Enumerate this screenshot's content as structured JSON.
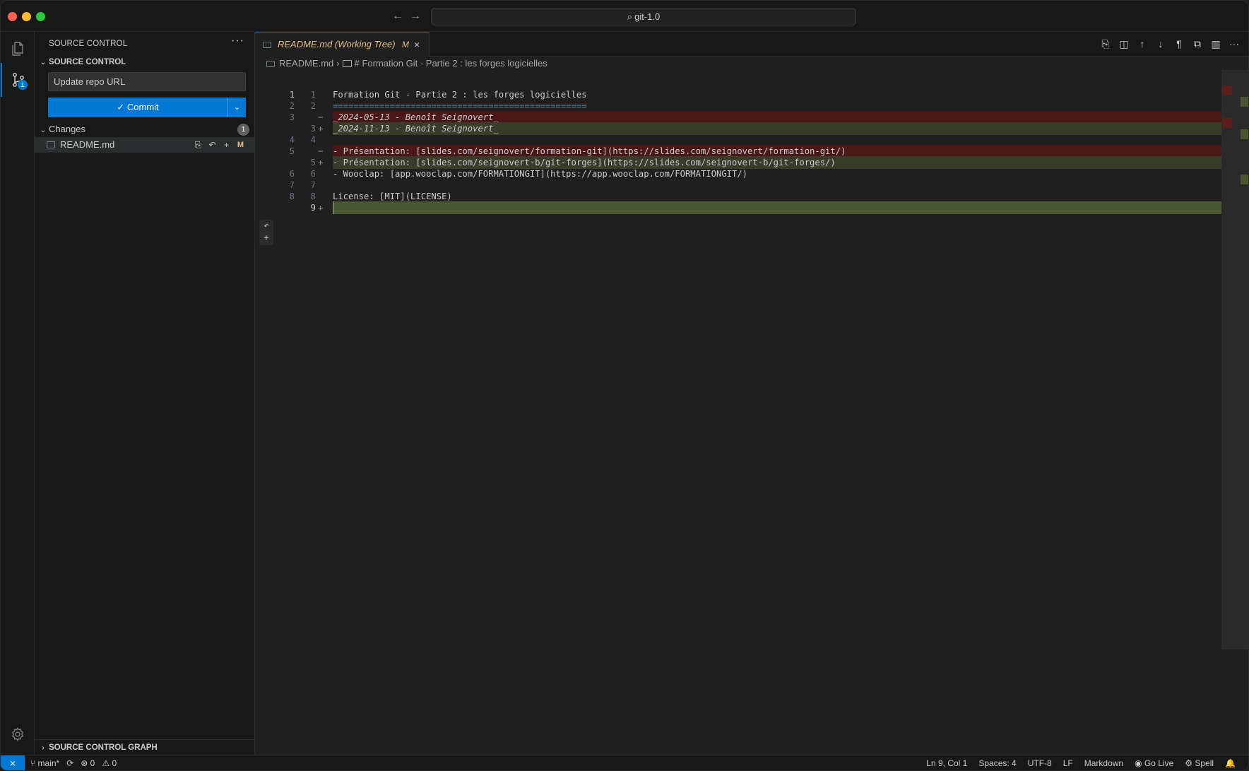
{
  "titlebar": {
    "title": "git-1.0",
    "back_glyph": "←",
    "forward_glyph": "→",
    "search_glyph": "⌕"
  },
  "activity": {
    "scm_badge": "1"
  },
  "sidebar": {
    "header": "SOURCE CONTROL",
    "more": "···",
    "section": "SOURCE CONTROL",
    "commit_message": "Update repo URL",
    "commit_label": "✓ Commit",
    "commit_dropdown": "⌄",
    "changes_label": "Changes",
    "changes_count": "1",
    "file": {
      "name": "README.md",
      "status": "M",
      "open_icon": "⎘",
      "discard_icon": "↶",
      "stage_icon": "+"
    },
    "graph_section": "SOURCE CONTROL GRAPH"
  },
  "editor": {
    "tab": {
      "label": "README.md (Working Tree)",
      "modified": "M",
      "close": "×"
    },
    "actions": [
      "⎘",
      "◫",
      "↑",
      "↓",
      "¶",
      "⧉",
      "▥",
      "···"
    ],
    "breadcrumb": {
      "file": "README.md",
      "sep": "›",
      "symbol": "# Formation Git - Partie 2 : les forges logicielles"
    },
    "gutter_actions": {
      "revert": "↶",
      "stage": "+"
    },
    "lines": [
      {
        "old": "1",
        "new": "1",
        "type": "context",
        "mark": "",
        "text": "Formation Git - Partie 2 : les forges logicielles"
      },
      {
        "old": "2",
        "new": "2",
        "type": "context",
        "mark": "",
        "text": "================================================="
      },
      {
        "old": "3",
        "new": "",
        "type": "removed",
        "mark": "−",
        "text": "_2024-05-13 - Benoît Seignovert_"
      },
      {
        "old": "",
        "new": "3",
        "type": "added",
        "mark": "+",
        "text": "_2024-11-13 - Benoît Seignovert_"
      },
      {
        "old": "4",
        "new": "4",
        "type": "context",
        "mark": "",
        "text": ""
      },
      {
        "old": "5",
        "new": "",
        "type": "removed",
        "mark": "−",
        "text": "- Présentation: [slides.com/seignovert/formation-git](https://slides.com/seignovert/formation-git/)"
      },
      {
        "old": "",
        "new": "5",
        "type": "added",
        "mark": "+",
        "text": "- Présentation: [slides.com/seignovert-b/git-forges](https://slides.com/seignovert-b/git-forges/)"
      },
      {
        "old": "6",
        "new": "6",
        "type": "context",
        "mark": "",
        "text": "- Wooclap: [app.wooclap.com/FORMATIONGIT](https://app.wooclap.com/FORMATIONGIT/)"
      },
      {
        "old": "7",
        "new": "7",
        "type": "context",
        "mark": "",
        "text": ""
      },
      {
        "old": "8",
        "new": "8",
        "type": "context",
        "mark": "",
        "text": "License: [MIT](LICENSE)"
      },
      {
        "old": "",
        "new": "9",
        "type": "added-bright",
        "mark": "+",
        "text": ""
      }
    ]
  },
  "statusbar": {
    "remote": "⨯",
    "branch": "main*",
    "sync": "⟳",
    "errors": "⊗ 0",
    "warnings": "⚠ 0",
    "position": "Ln 9, Col 1",
    "spaces": "Spaces: 4",
    "encoding": "UTF-8",
    "eol": "LF",
    "language": "Markdown",
    "golive": "Go Live",
    "spell": "Spell",
    "bell": "🔔"
  },
  "colors": {
    "accent": "#0078d4",
    "removed_bg": "#4b1818",
    "added_bg": "#373d29",
    "modified": "#e2c08d"
  }
}
